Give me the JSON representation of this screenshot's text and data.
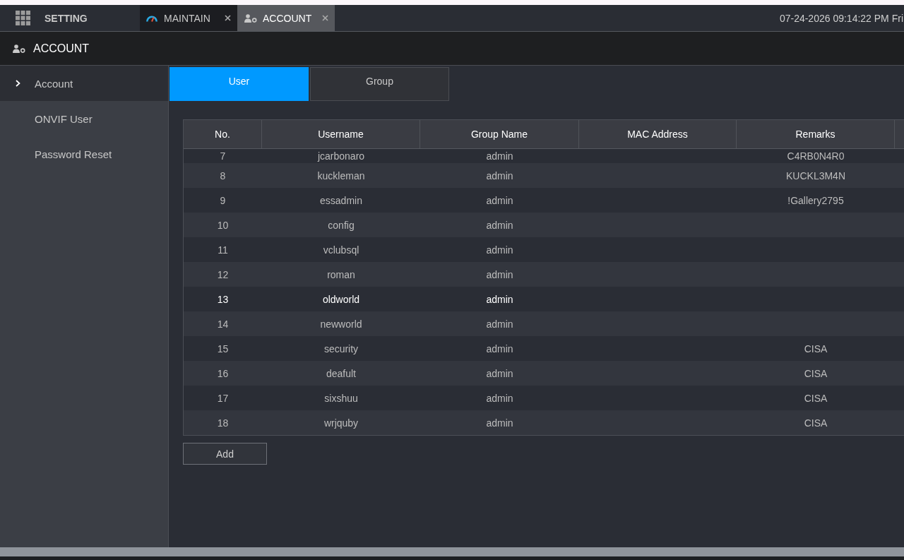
{
  "top_bar": {
    "menu_label": "SETTING",
    "tabs": [
      {
        "kind": "maintain",
        "label": "MAINTAIN",
        "selected": false
      },
      {
        "kind": "account",
        "label": "ACCOUNT",
        "selected": true
      }
    ],
    "datetime": "07-24-2026 09:14:22 PM Fri"
  },
  "page_header": {
    "title": "ACCOUNT"
  },
  "sidebar": {
    "items": [
      {
        "label": "Account",
        "selected": true
      },
      {
        "label": "ONVIF User",
        "selected": false
      },
      {
        "label": "Password Reset",
        "selected": false
      }
    ]
  },
  "subtabs": [
    {
      "label": "User",
      "selected": true
    },
    {
      "label": "Group",
      "selected": false
    }
  ],
  "table": {
    "columns": [
      "No.",
      "Username",
      "Group Name",
      "MAC Address",
      "Remarks"
    ],
    "rows": [
      {
        "no": "7",
        "username": "jcarbonaro",
        "group_name": "admin",
        "remarks": "C4RB0N4R0",
        "selected": false
      },
      {
        "no": "8",
        "username": "kuckleman",
        "group_name": "admin",
        "remarks": "KUCKL3M4N",
        "selected": false
      },
      {
        "no": "9",
        "username": "essadmin",
        "group_name": "admin",
        "remarks": "!Gallery2795",
        "selected": false
      },
      {
        "no": "10",
        "username": "config",
        "group_name": "admin",
        "selected": false
      },
      {
        "no": "11",
        "username": "vclubsql",
        "group_name": "admin",
        "selected": false
      },
      {
        "no": "12",
        "username": "roman",
        "group_name": "admin",
        "selected": false
      },
      {
        "no": "13",
        "username": "oldworld",
        "group_name": "admin",
        "selected": true
      },
      {
        "no": "14",
        "username": "newworld",
        "group_name": "admin",
        "selected": false
      },
      {
        "no": "15",
        "username": "security",
        "group_name": "admin",
        "remarks": "CISA",
        "selected": false
      },
      {
        "no": "16",
        "username": "deafult",
        "group_name": "admin",
        "remarks": "CISA",
        "selected": false
      },
      {
        "no": "17",
        "username": "sixshuu",
        "group_name": "admin",
        "remarks": "CISA",
        "selected": false
      },
      {
        "no": "18",
        "username": "wrjquby",
        "group_name": "admin",
        "remarks": "CISA",
        "selected": false
      }
    ]
  },
  "add_button": {
    "label": "Add"
  }
}
